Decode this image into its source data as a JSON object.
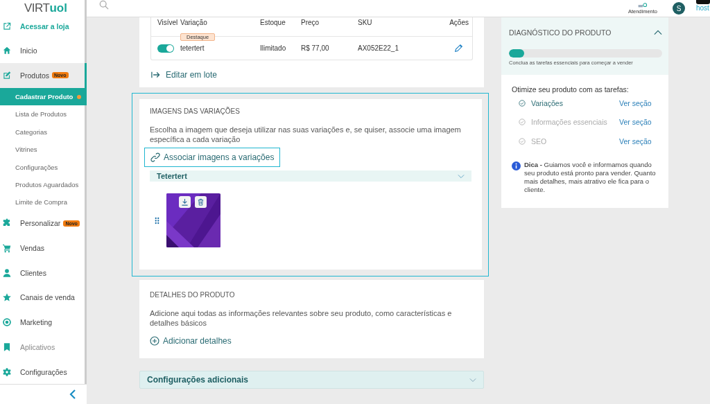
{
  "logo": {
    "text": "VIRT",
    "brand": "uol"
  },
  "topbar": {
    "support": "Atendimento",
    "avatar": "S",
    "partner": "host"
  },
  "sidebar": {
    "items": [
      {
        "label": "Acessar a loja",
        "kind": "link",
        "selected": false
      },
      {
        "label": "Inicio",
        "kind": "item",
        "selected": false
      },
      {
        "label": "Produtos",
        "kind": "item",
        "badge": "Novo",
        "selected": false,
        "expanded": true,
        "children": [
          {
            "label": "Cadastrar Produto",
            "selected": true,
            "dot": true
          },
          {
            "label": "Lista de Produtos",
            "selected": false
          },
          {
            "label": "Categorias",
            "selected": false
          },
          {
            "label": "Vitrines",
            "selected": false
          },
          {
            "label": "Configurações",
            "selected": false
          },
          {
            "label": "Produtos Aguardados",
            "selected": false
          },
          {
            "label": "Limite de Compra",
            "selected": false
          }
        ]
      },
      {
        "label": "Personalizar",
        "kind": "item",
        "badge": "Novo",
        "selected": false
      },
      {
        "label": "Vendas",
        "kind": "item",
        "selected": false
      },
      {
        "label": "Clientes",
        "kind": "item",
        "selected": false
      },
      {
        "label": "Canais de venda",
        "kind": "item",
        "selected": false
      },
      {
        "label": "Marketing",
        "kind": "item",
        "selected": false
      },
      {
        "label": "Aplicativos",
        "kind": "muted",
        "selected": false
      },
      {
        "label": "Configurações",
        "kind": "item",
        "selected": false
      }
    ]
  },
  "variations_table": {
    "columns": [
      "Visível",
      "Variação",
      "Estoque",
      "Preço",
      "SKU",
      "Ações"
    ],
    "rows": [
      {
        "visible": true,
        "badge": "Destaque",
        "variation": "tetertert",
        "stock": "Ilimitado",
        "price": "R$ 77,00",
        "sku": "AX052E22_1"
      }
    ]
  },
  "batch_edit": "Editar em lote",
  "images_section": {
    "title": "IMAGENS DAS VARIAÇÕES",
    "description": "Escolha a imagem que deseja utilizar nas suas variações e, se quiser, associe uma imagem específica a cada variação",
    "associate_button": "Associar imagens a variações",
    "variation": "Tetertert"
  },
  "details_section": {
    "title": "DETALHES DO PRODUTO",
    "description": "Adicione aqui todas as informações relevantes sobre seu produto, como características e detalhes básicos",
    "add_button": "Adicionar detalhes"
  },
  "additional_settings": "Configurações adicionais",
  "diagnostic": {
    "title": "DIAGNÓSTICO DO PRODUTO",
    "expanded": true,
    "level": 0.1,
    "caption": "Conclua as tarefas essenciais para começar a vender",
    "intro": "Otimize seu produto com as tarefas:",
    "tasks": [
      {
        "label": "Variações",
        "done": true,
        "link": "Ver seção"
      },
      {
        "label": "Informações essenciais",
        "done": false,
        "link": "Ver seção"
      },
      {
        "label": "SEO",
        "done": false,
        "link": "Ver seção"
      }
    ],
    "tip": "**Dica -** Guiamos você e informamos quando seu produto está pronto para vender. Quanto mais detalhes, mais atrativo ele fica para o cliente."
  }
}
